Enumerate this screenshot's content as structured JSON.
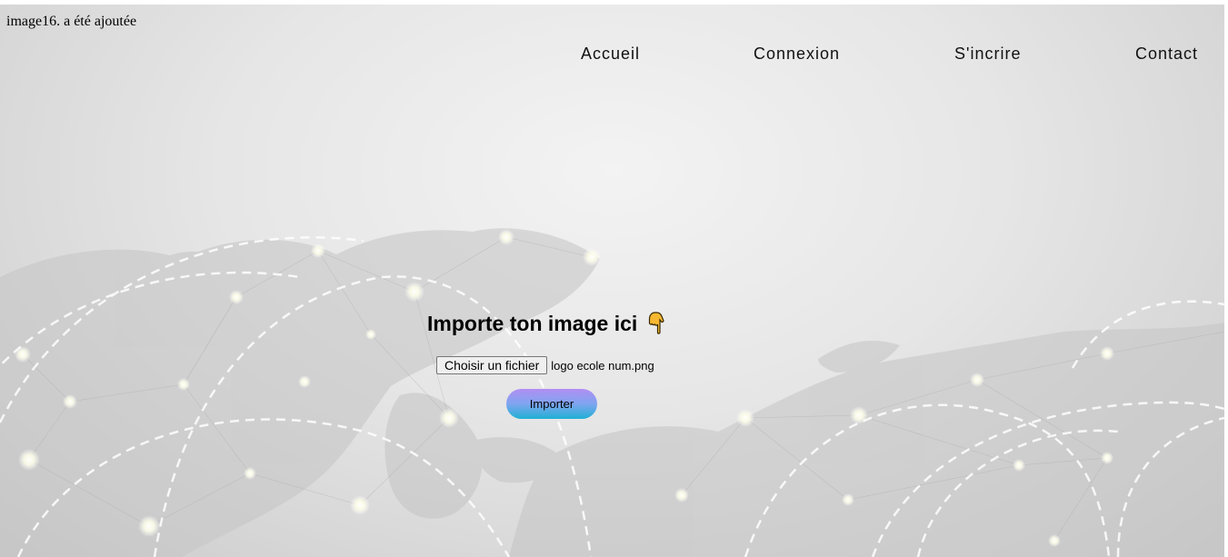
{
  "notice": {
    "text": "image16. a été ajoutée"
  },
  "nav": {
    "items": [
      {
        "label": "Accueil"
      },
      {
        "label": "Connexion"
      },
      {
        "label": "S'incrire"
      },
      {
        "label": "Contact"
      }
    ]
  },
  "upload": {
    "title": "Importe ton image ici",
    "title_icon": "hand-pointing-down-icon",
    "file_button_label": "Choisir un fichier",
    "file_name": "logo ecole num.png",
    "submit_label": "Importer"
  },
  "colors": {
    "button_gradient_top": "#b18ef2",
    "button_gradient_bottom": "#1fb0d4",
    "background": "#e6e6e6"
  }
}
